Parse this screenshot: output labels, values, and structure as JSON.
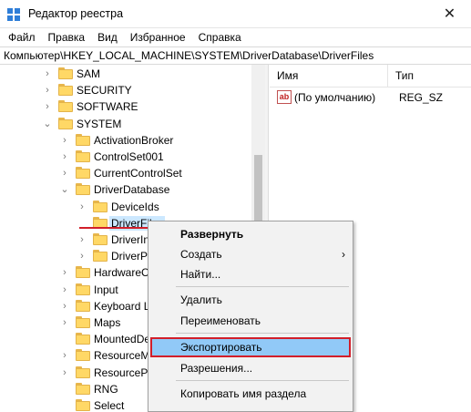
{
  "window": {
    "title": "Редактор реестра",
    "close_glyph": "✕"
  },
  "menubar": {
    "items": [
      "Файл",
      "Правка",
      "Вид",
      "Избранное",
      "Справка"
    ]
  },
  "address": {
    "path": "Компьютер\\HKEY_LOCAL_MACHINE\\SYSTEM\\DriverDatabase\\DriverFiles"
  },
  "tree": {
    "rows": [
      {
        "label": "SAM",
        "expander": "›",
        "level": 0
      },
      {
        "label": "SECURITY",
        "expander": "›",
        "level": 0
      },
      {
        "label": "SOFTWARE",
        "expander": "›",
        "level": 0
      },
      {
        "label": "SYSTEM",
        "expander": "⌄",
        "level": 0
      },
      {
        "label": "ActivationBroker",
        "expander": "›",
        "level": 1
      },
      {
        "label": "ControlSet001",
        "expander": "›",
        "level": 1
      },
      {
        "label": "CurrentControlSet",
        "expander": "›",
        "level": 1
      },
      {
        "label": "DriverDatabase",
        "expander": "⌄",
        "level": 1
      },
      {
        "label": "DeviceIds",
        "expander": "›",
        "level": 2
      },
      {
        "label": "DriverFiles",
        "expander": "",
        "level": 2,
        "selected": true
      },
      {
        "label": "DriverIn",
        "expander": "›",
        "level": 2
      },
      {
        "label": "DriverPa",
        "expander": "›",
        "level": 2
      },
      {
        "label": "HardwareC",
        "expander": "›",
        "level": 1
      },
      {
        "label": "Input",
        "expander": "›",
        "level": 1
      },
      {
        "label": "Keyboard L",
        "expander": "›",
        "level": 1
      },
      {
        "label": "Maps",
        "expander": "›",
        "level": 1
      },
      {
        "label": "MountedDe",
        "expander": "",
        "level": 1
      },
      {
        "label": "ResourceM",
        "expander": "›",
        "level": 1
      },
      {
        "label": "ResourcePo",
        "expander": "›",
        "level": 1
      },
      {
        "label": "RNG",
        "expander": "",
        "level": 1
      },
      {
        "label": "Select",
        "expander": "",
        "level": 1
      }
    ]
  },
  "values": {
    "columns": {
      "name": "Имя",
      "type": "Тип"
    },
    "rows": [
      {
        "icon": "ab",
        "name": "(По умолчанию)",
        "type": "REG_SZ"
      }
    ]
  },
  "context_menu": {
    "items": [
      {
        "label": "Развернуть",
        "bold": true
      },
      {
        "label": "Создать",
        "submenu_arrow": "›"
      },
      {
        "label": "Найти..."
      },
      {
        "separator": true
      },
      {
        "label": "Удалить"
      },
      {
        "label": "Переименовать"
      },
      {
        "separator": true
      },
      {
        "label": "Экспортировать",
        "highlighted": true
      },
      {
        "label": "Разрешения..."
      },
      {
        "separator": true
      },
      {
        "label": "Копировать имя раздела"
      }
    ]
  },
  "colors": {
    "highlight_border": "#d21f2a",
    "menu_highlight": "#91c9f7",
    "selection": "#cce8ff",
    "folder": "#ffd866"
  }
}
